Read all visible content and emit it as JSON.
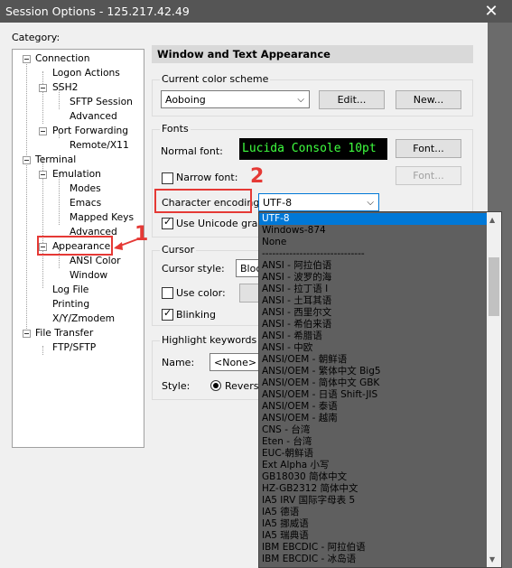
{
  "window": {
    "title": "Session Options - 125.217.42.49",
    "close_glyph": "✕"
  },
  "category_label": "Category:",
  "tree": [
    {
      "label": "Connection"
    },
    {
      "label": "Logon Actions"
    },
    {
      "label": "SSH2"
    },
    {
      "label": "SFTP Session"
    },
    {
      "label": "Advanced"
    },
    {
      "label": "Port Forwarding"
    },
    {
      "label": "Remote/X11"
    },
    {
      "label": "Terminal"
    },
    {
      "label": "Emulation"
    },
    {
      "label": "Modes"
    },
    {
      "label": "Emacs"
    },
    {
      "label": "Mapped Keys"
    },
    {
      "label": "Advanced"
    },
    {
      "label": "Appearance"
    },
    {
      "label": "ANSI Color"
    },
    {
      "label": "Window"
    },
    {
      "label": "Log File"
    },
    {
      "label": "Printing"
    },
    {
      "label": "X/Y/Zmodem"
    },
    {
      "label": "File Transfer"
    },
    {
      "label": "FTP/SFTP"
    }
  ],
  "panel": {
    "title": "Window and Text Appearance",
    "color_scheme": {
      "group": "Current color scheme",
      "value": "Aoboing",
      "edit": "Edit...",
      "new": "New..."
    },
    "fonts": {
      "group": "Fonts",
      "normal_label": "Normal font:",
      "normal_value": "Lucida Console 10pt",
      "font_button": "Font...",
      "narrow_label": "Narrow font:",
      "narrow_button": "Font...",
      "encoding_label": "Character encoding:",
      "encoding_value": "UTF-8",
      "unicode_label": "Use Unicode graphi"
    },
    "cursor": {
      "group": "Cursor",
      "style_label": "Cursor style:",
      "style_value": "Bloc",
      "color_label": "Use color:",
      "blink_label": "Blinking"
    },
    "highlight": {
      "group": "Highlight keywords",
      "name_label": "Name:",
      "name_value": "<None>",
      "style_label": "Style:",
      "reverse_label": "Reverse"
    }
  },
  "encoding_options": [
    "UTF-8",
    "Windows-874",
    "None",
    "------------------------------",
    "ANSI - 阿拉伯语",
    "ANSI - 波罗的海",
    "ANSI - 拉丁语 I",
    "ANSI - 土耳其语",
    "ANSI - 西里尔文",
    "ANSI - 希伯来语",
    "ANSI - 希腊语",
    "ANSI - 中欧",
    "ANSI/OEM - 朝鲜语",
    "ANSI/OEM - 繁体中文 Big5",
    "ANSI/OEM - 简体中文 GBK",
    "ANSI/OEM - 日语 Shift-JIS",
    "ANSI/OEM - 泰语",
    "ANSI/OEM - 越南",
    "CNS - 台湾",
    "Eten - 台湾",
    "EUC-朝鲜语",
    "Ext Alpha 小写",
    "GB18030 简体中文",
    "HZ-GB2312 简体中文",
    "IA5 IRV 国际字母表 5",
    "IA5 德语",
    "IA5 挪威语",
    "IA5 瑞典语",
    "IBM EBCDIC - 阿拉伯语",
    "IBM EBCDIC - 冰岛语"
  ],
  "annotations": {
    "marker_1": "1",
    "marker_2": "2"
  },
  "colors": {
    "accent": "#0078d7",
    "highlight": "#e53935",
    "preview_fg": "#3fff3f"
  }
}
